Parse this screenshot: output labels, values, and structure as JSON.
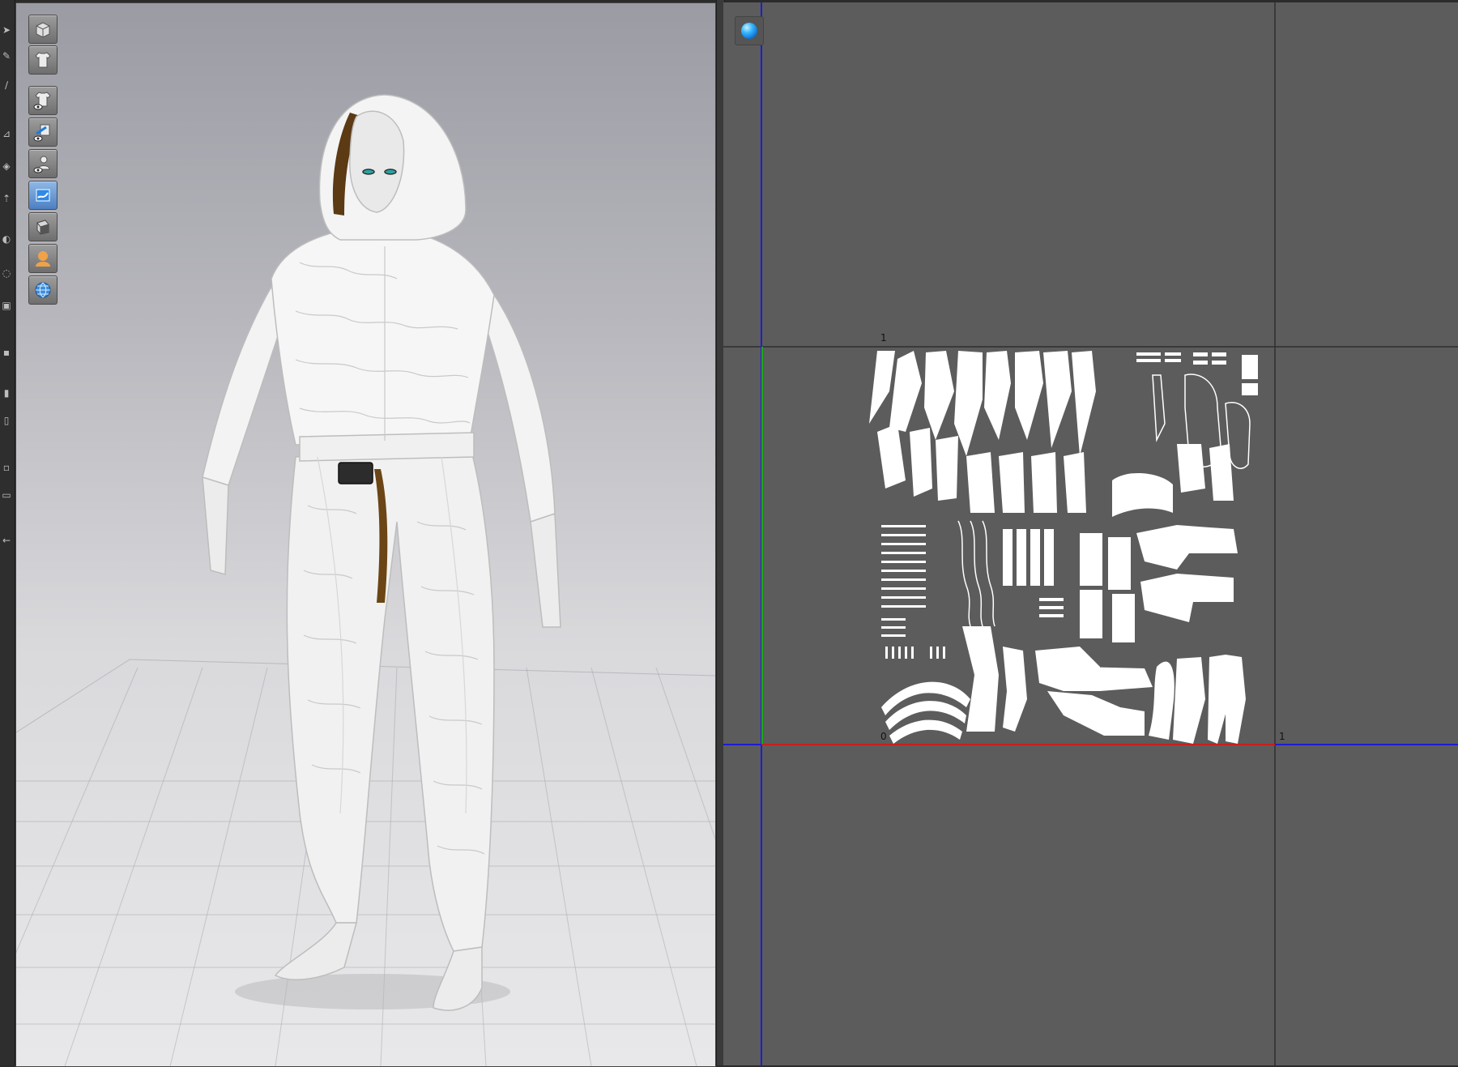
{
  "left_toolbar": {
    "tools": [
      "pointer-tool-icon",
      "pen-tool-icon",
      "brush-tool-icon",
      "pin-tool-icon",
      "bucket-tool-icon",
      "arrow-tool-icon",
      "rotate-tool-icon",
      "lasso-tool-icon",
      "layers-tool-icon",
      "square-tool-icon",
      "bar-tool-icon",
      "tall-bar-tool-icon",
      "small-square-tool-icon",
      "panel-tool-icon",
      "back-arrow-icon"
    ]
  },
  "viewport": {
    "buttons": [
      {
        "name": "avatar-view-button",
        "icon": "cube-icon"
      },
      {
        "name": "garment-view-button",
        "icon": "shirt-icon"
      },
      {
        "name": "show-garment-button",
        "icon": "shirt-eye-icon"
      },
      {
        "name": "show-pins-button",
        "icon": "pin-eye-icon"
      },
      {
        "name": "show-avatar-button",
        "icon": "avatar-eye-icon"
      },
      {
        "name": "texture-button",
        "icon": "texture-icon",
        "active": true
      },
      {
        "name": "shading-button",
        "icon": "shading-icon"
      },
      {
        "name": "skin-button",
        "icon": "skin-avatar-icon"
      },
      {
        "name": "globe-button",
        "icon": "globe-icon"
      }
    ],
    "colors": {
      "garment": "#f2f2f2",
      "hair": "#5b3a14",
      "grid": "#8a8a94"
    }
  },
  "uv_editor": {
    "button_icon": "sphere-icon",
    "labels": {
      "v_top": "1",
      "origin": "0",
      "u_right": "1"
    },
    "colors": {
      "background": "#5c5c5c",
      "axis_blue": "#1d1dd6",
      "axis_red": "#c81e1e",
      "axis_green": "#1da51d",
      "grid": "#2e2e2e",
      "pieces": "#ffffff"
    }
  }
}
